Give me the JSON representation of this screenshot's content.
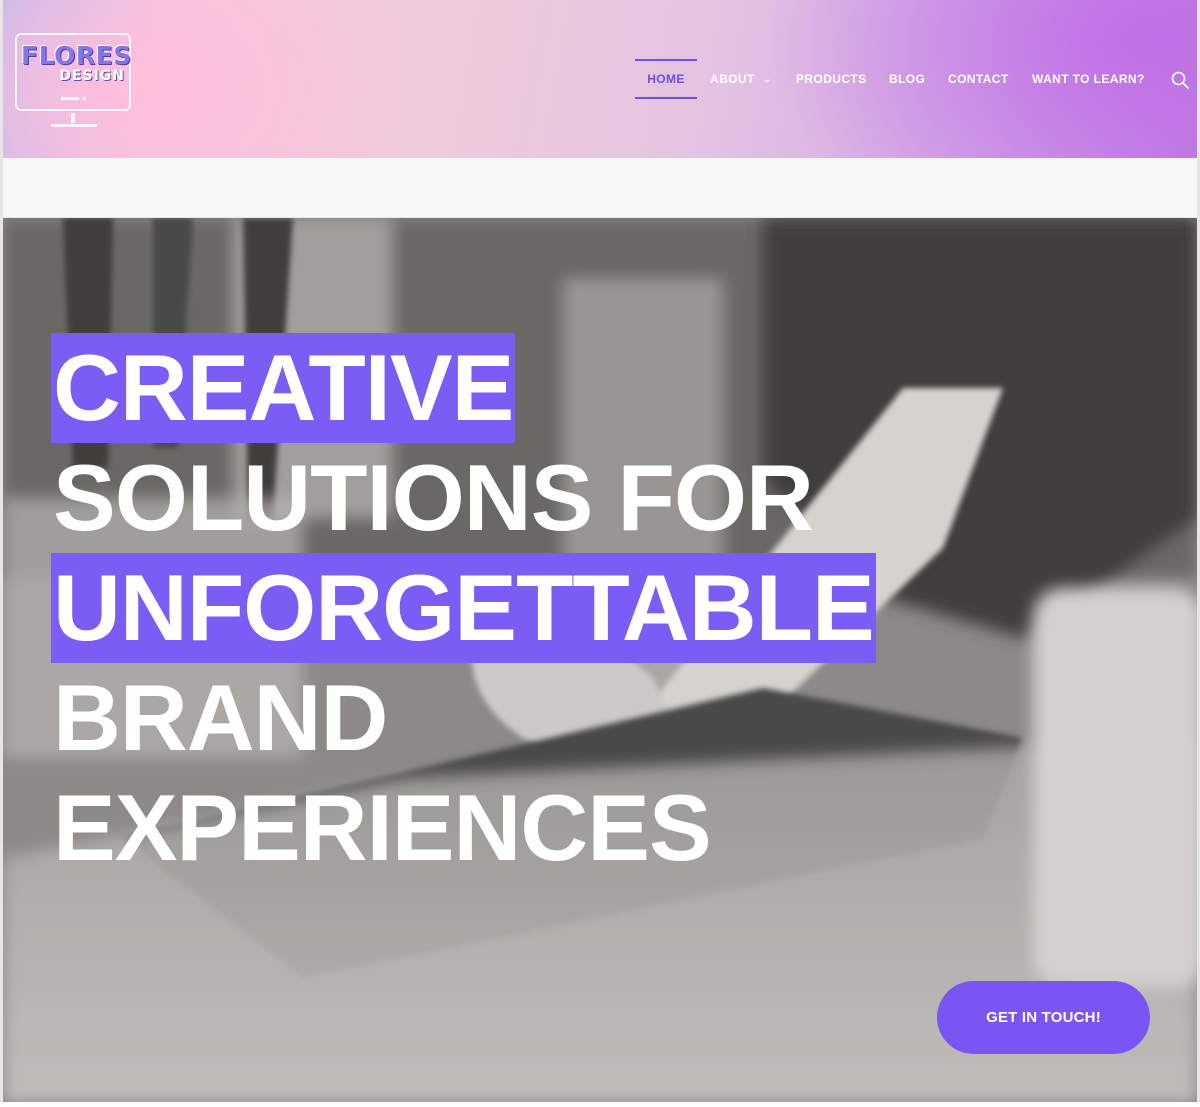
{
  "logo": {
    "line1": "FLORES",
    "line2": "DESIGN",
    "icon": "monitor-icon"
  },
  "nav": {
    "items": [
      {
        "label": "HOME",
        "active": true
      },
      {
        "label": "ABOUT",
        "has_dropdown": true,
        "dropdown_icon": "chevron-down-icon"
      },
      {
        "label": "PRODUCTS"
      },
      {
        "label": "BLOG"
      },
      {
        "label": "CONTACT"
      },
      {
        "label": "WANT TO LEARN?"
      }
    ],
    "search_icon": "search-icon"
  },
  "hero": {
    "lines": [
      {
        "text": "CREATIVE",
        "highlighted": true
      },
      {
        "text": "SOLUTIONS FOR",
        "highlighted": false
      },
      {
        "text": "UNFORGETTABLE",
        "highlighted": true
      },
      {
        "text": "BRAND",
        "highlighted": false
      },
      {
        "text": "EXPERIENCES",
        "highlighted": false
      }
    ],
    "cta_label": "GET IN TOUCH!"
  },
  "colors": {
    "accent": "#7a55f3",
    "highlight": "#7b5cf5",
    "nav_active": "#6c4ee8",
    "text_on_dark": "#ffffff"
  }
}
